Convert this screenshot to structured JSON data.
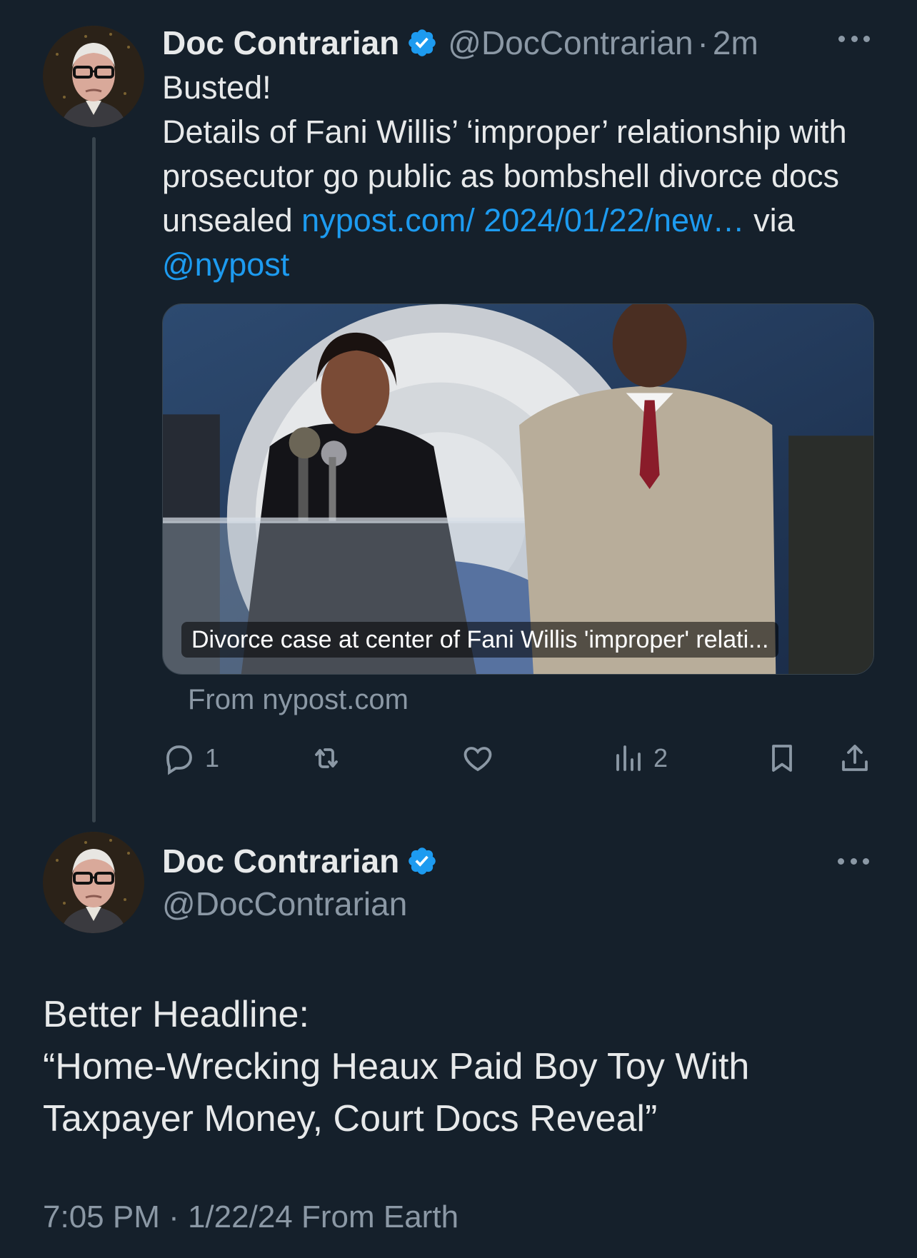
{
  "thread": {
    "tweet1": {
      "author_name": "Doc Contrarian",
      "handle": "@DocContrarian",
      "separator": "·",
      "time_ago": "2m",
      "text_line1": "Busted!",
      "text_main": "Details of Fani Willis’ ‘improper’ relationship with prosecutor go public as bombshell divorce docs unsealed ",
      "link_text": "nypost.com/ 2024/01/22/new…",
      "via_text": " via ",
      "mention": "@nypost",
      "card": {
        "caption": "Divorce case at center of Fani Willis 'improper' relati...",
        "source": "From nypost.com"
      },
      "actions": {
        "reply_count": "1",
        "retweet_count": "",
        "like_count": "",
        "views_count": "2"
      }
    },
    "tweet2": {
      "author_name": "Doc Contrarian",
      "handle": "@DocContrarian",
      "text_line1": "Better Headline:",
      "text_line2": "“Home-Wrecking Heaux Paid Boy Toy With Taxpayer Money, Court Docs Reveal”",
      "meta": "7:05 PM · 1/22/24 From Earth"
    }
  },
  "colors": {
    "background": "#15202b",
    "text": "#e7e9ea",
    "secondary": "#8b98a5",
    "link": "#1d9bf0",
    "verified": "#1d9bf0"
  }
}
